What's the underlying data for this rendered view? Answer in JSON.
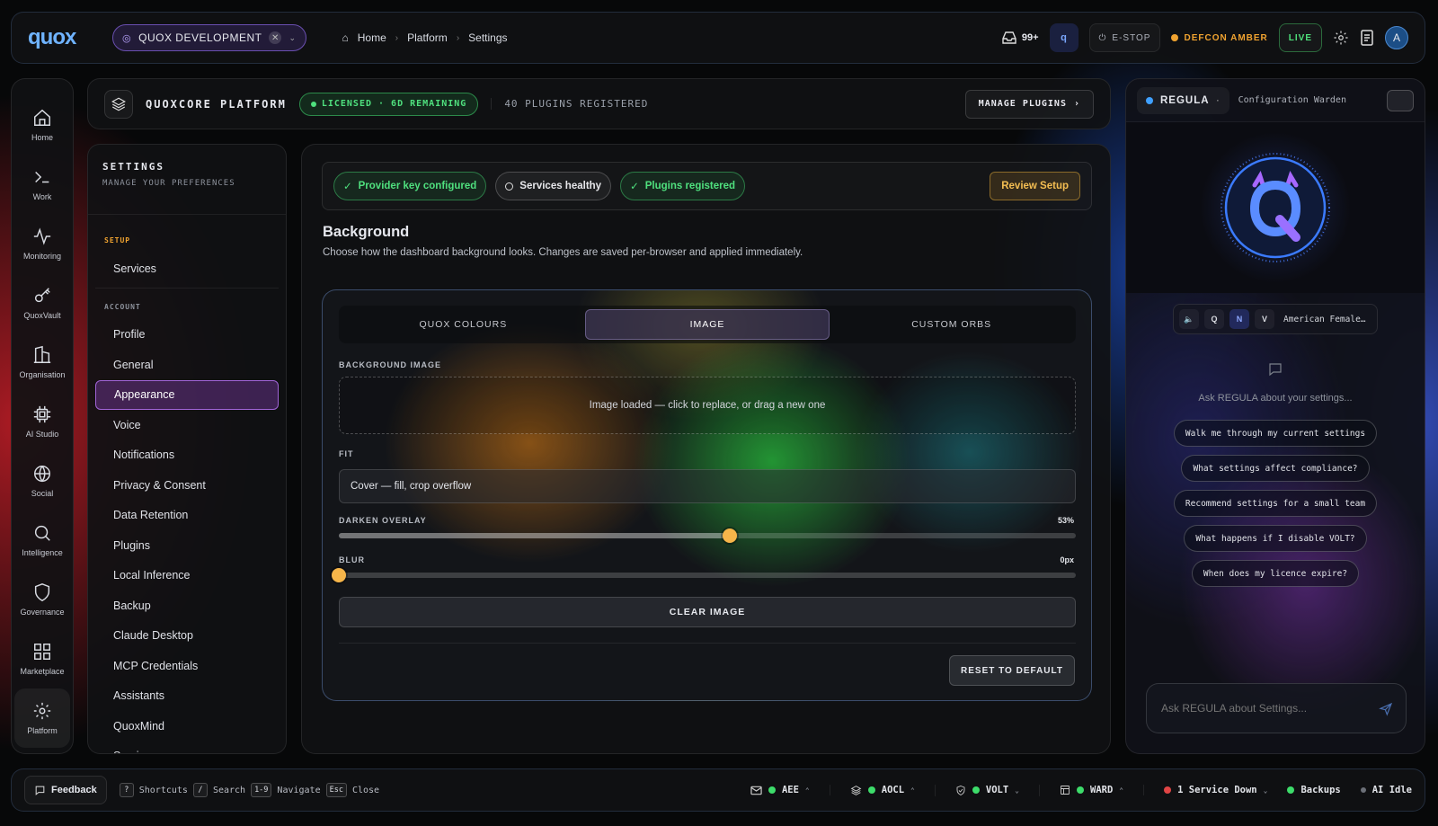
{
  "topbar": {
    "logo": "quox",
    "org": "QUOX DEVELOPMENT",
    "breadcrumbs": [
      "Home",
      "Platform",
      "Settings"
    ],
    "inbox_count": "99+",
    "estop_label": "E-STOP",
    "defcon_label": "DEFCON AMBER",
    "live_label": "LIVE",
    "avatar_initial": "A",
    "colors": {
      "defcon": "#f0a330",
      "live": "#4ee07a",
      "accent": "#6fb3ff"
    }
  },
  "leftnav": {
    "items": [
      {
        "label": "Home",
        "icon": "home-icon"
      },
      {
        "label": "Work",
        "icon": "terminal-icon"
      },
      {
        "label": "Monitoring",
        "icon": "activity-icon"
      },
      {
        "label": "QuoxVault",
        "icon": "key-icon"
      },
      {
        "label": "Organisation",
        "icon": "building-icon"
      },
      {
        "label": "AI Studio",
        "icon": "chip-icon"
      },
      {
        "label": "Social",
        "icon": "globe-icon"
      },
      {
        "label": "Intelligence",
        "icon": "search-icon"
      },
      {
        "label": "Governance",
        "icon": "shield-icon"
      },
      {
        "label": "Marketplace",
        "icon": "grid-icon"
      },
      {
        "label": "Platform",
        "icon": "gear-icon"
      }
    ],
    "active": "Platform"
  },
  "platform": {
    "title": "QUOXCORE PLATFORM",
    "license": "LICENSED · 6D REMAINING",
    "plugins_registered": "40 PLUGINS REGISTERED",
    "manage_label": "MANAGE PLUGINS"
  },
  "settings": {
    "title": "SETTINGS",
    "subtitle": "MANAGE YOUR PREFERENCES",
    "setup_label": "SETUP",
    "setup_items": [
      "Services"
    ],
    "account_label": "ACCOUNT",
    "account_items": [
      "Profile",
      "General",
      "Appearance",
      "Voice",
      "Notifications",
      "Privacy & Consent",
      "Data Retention",
      "Plugins",
      "Local Inference",
      "Backup",
      "Claude Desktop",
      "MCP Credentials",
      "Assistants",
      "QuoxMind",
      "Services"
    ],
    "active": "Appearance"
  },
  "main": {
    "status_chips": [
      {
        "label": "Provider key configured",
        "state": "ok"
      },
      {
        "label": "Services healthy",
        "state": "neutral"
      },
      {
        "label": "Plugins registered",
        "state": "ok"
      }
    ],
    "review_label": "Review Setup",
    "title": "Background",
    "description": "Choose how the dashboard background looks. Changes are saved per-browser and applied immediately.",
    "tabs": [
      "QUOX COLOURS",
      "IMAGE",
      "CUSTOM ORBS"
    ],
    "active_tab": "IMAGE",
    "bg_image_label": "BACKGROUND IMAGE",
    "dropzone_text": "Image loaded — click to replace, or drag a new one",
    "fit_label": "FIT",
    "fit_value": "Cover — fill, crop overflow",
    "darken_label": "DARKEN OVERLAY",
    "darken_value": "53%",
    "darken_fraction": 0.53,
    "blur_label": "BLUR",
    "blur_value": "0px",
    "blur_fraction": 0,
    "clear_label": "CLEAR IMAGE",
    "reset_label": "RESET TO DEFAULT"
  },
  "regula": {
    "name": "REGULA",
    "subtitle": "Configuration Warden",
    "voice_modes": [
      "Q",
      "N",
      "V"
    ],
    "active_voice_mode": "N",
    "voice_name": "American Female…",
    "ask_hint": "Ask REGULA about your settings...",
    "suggestions": [
      "Walk me through my current settings",
      "What settings affect compliance?",
      "Recommend settings for a small team",
      "What happens if I disable VOLT?",
      "When does my licence expire?"
    ],
    "input_placeholder": "Ask REGULA about Settings..."
  },
  "footer": {
    "feedback_label": "Feedback",
    "hotkeys": [
      {
        "key": "?",
        "label": "Shortcuts"
      },
      {
        "key": "/",
        "label": "Search"
      },
      {
        "key": "1-9",
        "label": "Navigate"
      },
      {
        "key": "Esc",
        "label": "Close"
      }
    ],
    "stats": [
      {
        "label": "AEE",
        "icon": "mail-icon",
        "status": "#3ddc6a"
      },
      {
        "label": "AOCL",
        "icon": "layers-icon",
        "status": "#3ddc6a"
      },
      {
        "label": "VOLT",
        "icon": "shield-check-icon",
        "status": "#3ddc6a"
      },
      {
        "label": "WARD",
        "icon": "window-icon",
        "status": "#3ddc6a"
      },
      {
        "label": "1 Service Down",
        "status": "#e04545"
      },
      {
        "label": "Backups",
        "status": "#3ddc6a"
      },
      {
        "label": "AI Idle",
        "status": "#6b6f77"
      }
    ]
  }
}
